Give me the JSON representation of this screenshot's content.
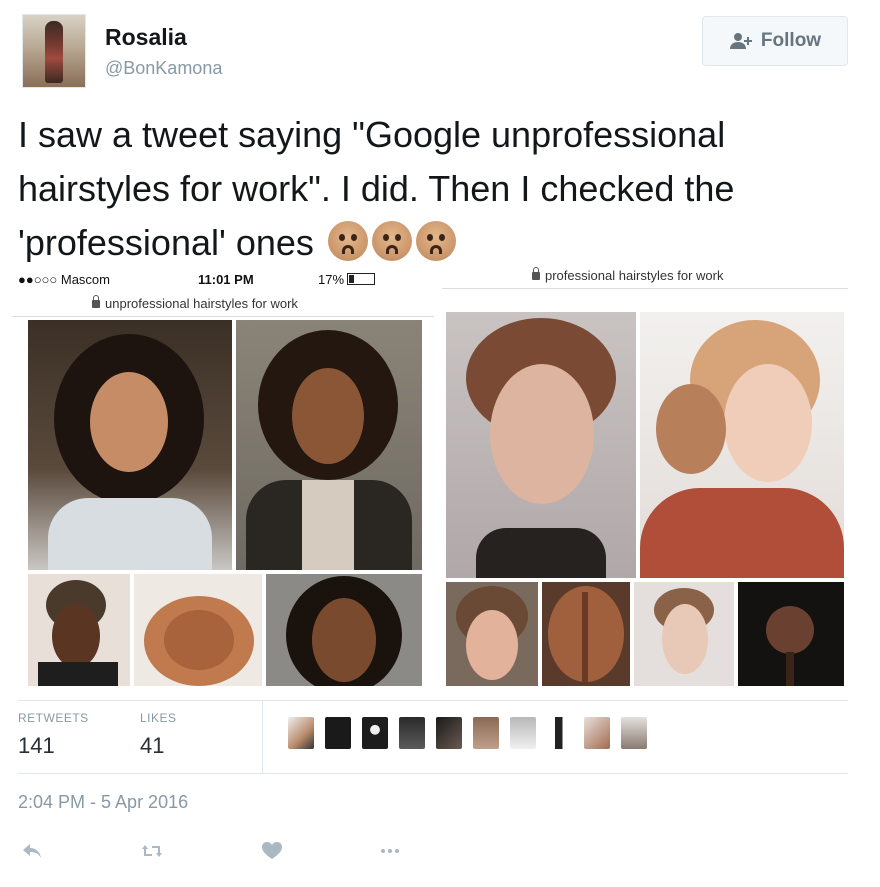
{
  "author": {
    "name": "Rosalia",
    "handle": "@BonKamona"
  },
  "follow_button": {
    "label": "Follow",
    "icon": "add-user-icon"
  },
  "tweet": {
    "lines": [
      "I saw a tweet saying \"Google unprofessional",
      "hairstyles for work\". I did. Then I checked the",
      "'professional' ones"
    ],
    "emoji_count": 3
  },
  "media": {
    "left": {
      "carrier": "●●○○○ Mascom",
      "time": "11:01 PM",
      "battery": "17%",
      "url": "unprofessional hairstyles for work"
    },
    "right": {
      "url": "professional hairstyles for work"
    }
  },
  "stats": {
    "retweets_label": "RETWEETS",
    "retweets_value": "141",
    "likes_label": "LIKES",
    "likes_value": "41"
  },
  "timestamp": "2:04 PM - 5 Apr 2016",
  "actions": [
    "reply-icon",
    "retweet-icon",
    "like-icon",
    "more-icon"
  ],
  "colors": {
    "text": "#14171a",
    "muted": "#8899a6",
    "border": "#e1e8ed",
    "follow_bg": "#f5f8fa"
  }
}
